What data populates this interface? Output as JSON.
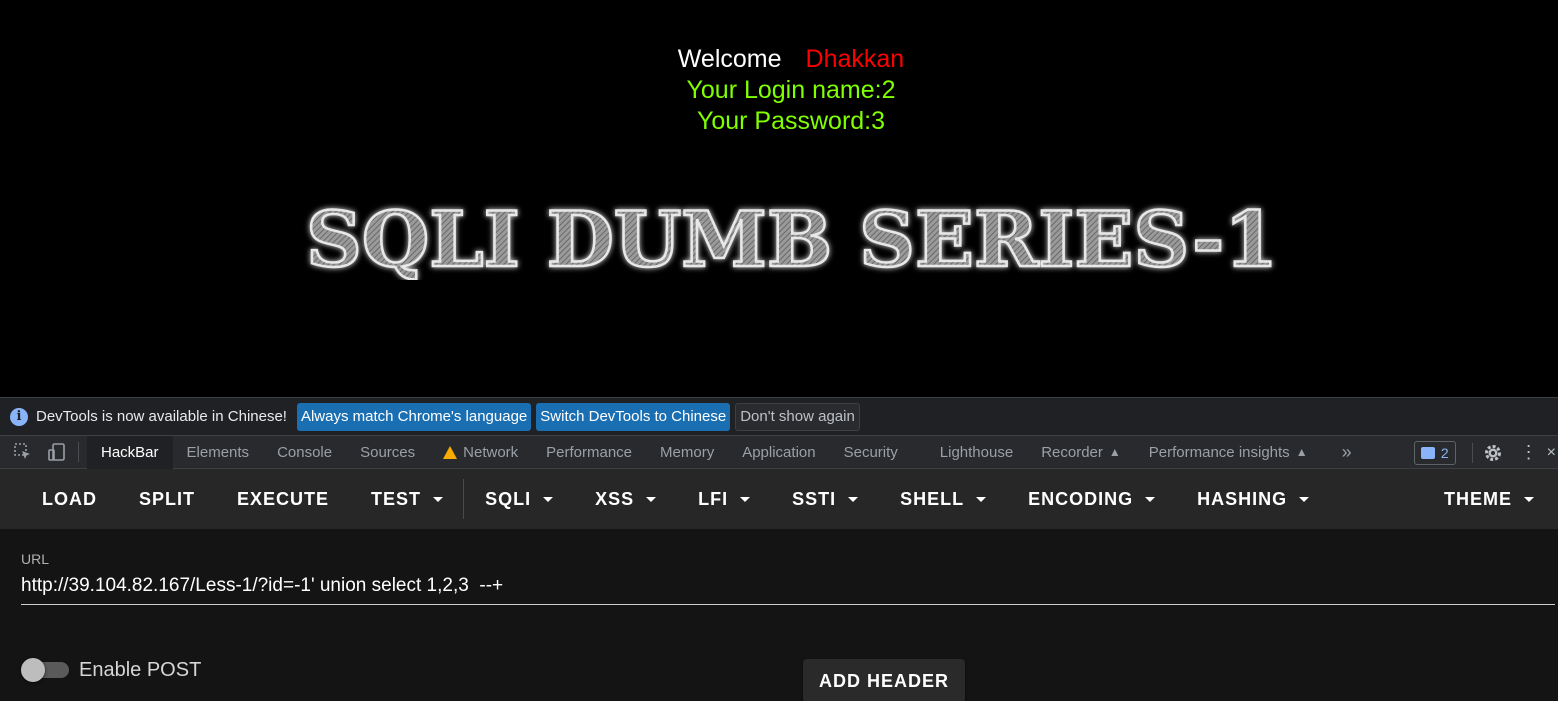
{
  "page": {
    "welcome_word": "Welcome",
    "welcome_user": "Dhakkan",
    "login_name": "Your Login name:2",
    "password": "Your Password:3",
    "banner_text": "SQLI DUMB SERIES-1"
  },
  "infobar": {
    "message": "DevTools is now available in Chinese!",
    "btn_always_match": "Always match Chrome's language",
    "btn_switch": "Switch DevTools to Chinese",
    "btn_dont_show": "Don't show again"
  },
  "tabs": {
    "hackbar": "HackBar",
    "elements": "Elements",
    "console": "Console",
    "sources": "Sources",
    "network": "Network",
    "performance": "Performance",
    "memory": "Memory",
    "application": "Application",
    "security": "Security",
    "lighthouse": "Lighthouse",
    "recorder": "Recorder",
    "performance_insights": "Performance insights",
    "more": "»",
    "issues_count": "2"
  },
  "hackbar": {
    "menu": {
      "load": "LOAD",
      "split": "SPLIT",
      "execute": "EXECUTE",
      "test": "TEST",
      "sqli": "SQLI",
      "xss": "XSS",
      "lfi": "LFI",
      "ssti": "SSTI",
      "shell": "SHELL",
      "encoding": "ENCODING",
      "hashing": "HASHING",
      "theme": "THEME"
    },
    "url_label": "URL",
    "url_value": "http://39.104.82.167/Less-1/?id=-1' union select 1,2,3  --+",
    "enable_post_label": "Enable POST",
    "add_header_label": "ADD HEADER"
  },
  "colors": {
    "welcome_user": "#ff0000",
    "login_text": "#7fff00",
    "infobar_button": "#1a6fb3"
  }
}
